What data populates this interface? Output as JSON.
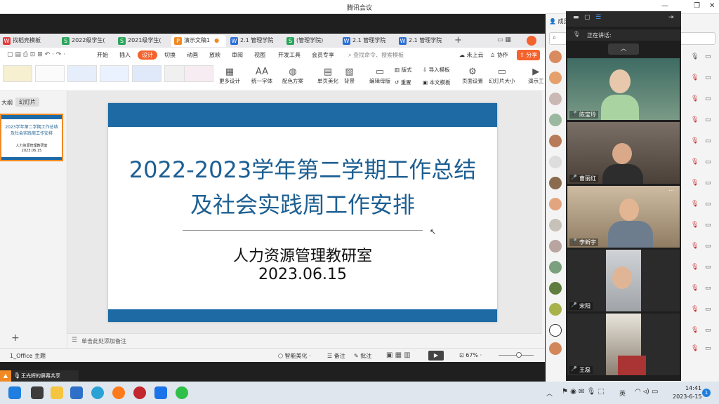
{
  "meeting": {
    "title": "腾讯会议",
    "window_controls": [
      "—",
      "❐",
      "✕"
    ],
    "member_header_name": "成员",
    "speaking_label": "正在讲话:"
  },
  "wps": {
    "tabs": [
      {
        "label": "找稻壳模板",
        "icon_color": "#e23b3b",
        "active": false
      },
      {
        "label": "2022级学生(",
        "icon_color": "#2ca55a",
        "active": false
      },
      {
        "label": "2021级学生(",
        "icon_color": "#2ca55a",
        "active": false
      },
      {
        "label": "演示文稿1",
        "icon_color": "#f08a24",
        "active": true
      },
      {
        "label": "2.1 管理学院",
        "icon_color": "#2b6fd6",
        "active": false
      },
      {
        "label": "(管理学院)",
        "icon_color": "#2ca55a",
        "active": false
      },
      {
        "label": "2.1 管理学院",
        "icon_color": "#2b6fd6",
        "active": false
      },
      {
        "label": "2.1 管理学院",
        "icon_color": "#2b6fd6",
        "active": false
      }
    ],
    "new_tab_icon": "plus-icon",
    "menu": [
      "开始",
      "插入",
      "设计",
      "切换",
      "动画",
      "放映",
      "审阅",
      "视图",
      "开发工具",
      "会员专享"
    ],
    "menu_active": "设计",
    "search_placeholder": "查找命令、搜索模板",
    "cloud_status": "未上云",
    "collab_label": "协作",
    "share_label": "分享",
    "ribbon": [
      {
        "label": "更多设计",
        "glyph": "▦"
      },
      {
        "label": "统一字体",
        "glyph": "AA"
      },
      {
        "label": "配色方案",
        "glyph": "◍"
      },
      {
        "label": "单页美化",
        "glyph": "▤"
      },
      {
        "label": "背景",
        "glyph": "▧"
      },
      {
        "label": "编辑母版",
        "glyph": "▭"
      },
      {
        "label": "版式",
        "glyph": "▥"
      },
      {
        "label": "重置",
        "glyph": "↺"
      },
      {
        "label": "导入模板",
        "glyph": "⇩"
      },
      {
        "label": "本文模板",
        "glyph": "▣"
      },
      {
        "label": "页面设置",
        "glyph": "⚙"
      },
      {
        "label": "幻灯片大小",
        "glyph": "▭"
      },
      {
        "label": "演示工",
        "glyph": "▶"
      }
    ],
    "left_tabs": [
      "大纲",
      "幻灯片"
    ],
    "thumb_title": "2023学年第二学期工作总结\n及社会实践周工作安排",
    "thumb_sub": "人力资源管理教研室\n2023.06.15",
    "slide": {
      "title_line1": "2022-2023学年第二学期工作总结",
      "title_line2": "及社会实践周工作安排",
      "subtitle": "人力资源管理教研室",
      "date": "2023.06.15",
      "accent": "#1d6aa5"
    },
    "notes_placeholder": "单击此处添加备注",
    "status": {
      "theme": "1_Office 主题",
      "smart_beautify": "智能美化",
      "notes": "备注",
      "comments": "批注",
      "zoom": "67%"
    }
  },
  "share_bar": {
    "label": "王光辉的屏幕共享"
  },
  "video_participants": [
    {
      "name": "陈宝玲"
    },
    {
      "name": "曹丽红"
    },
    {
      "name": "李新宇"
    },
    {
      "name": "宋阳"
    },
    {
      "name": "王磊"
    }
  ],
  "taskbar": {
    "time": "14:41",
    "date": "2023-6-15",
    "ime": "英",
    "notification_count": "1"
  }
}
